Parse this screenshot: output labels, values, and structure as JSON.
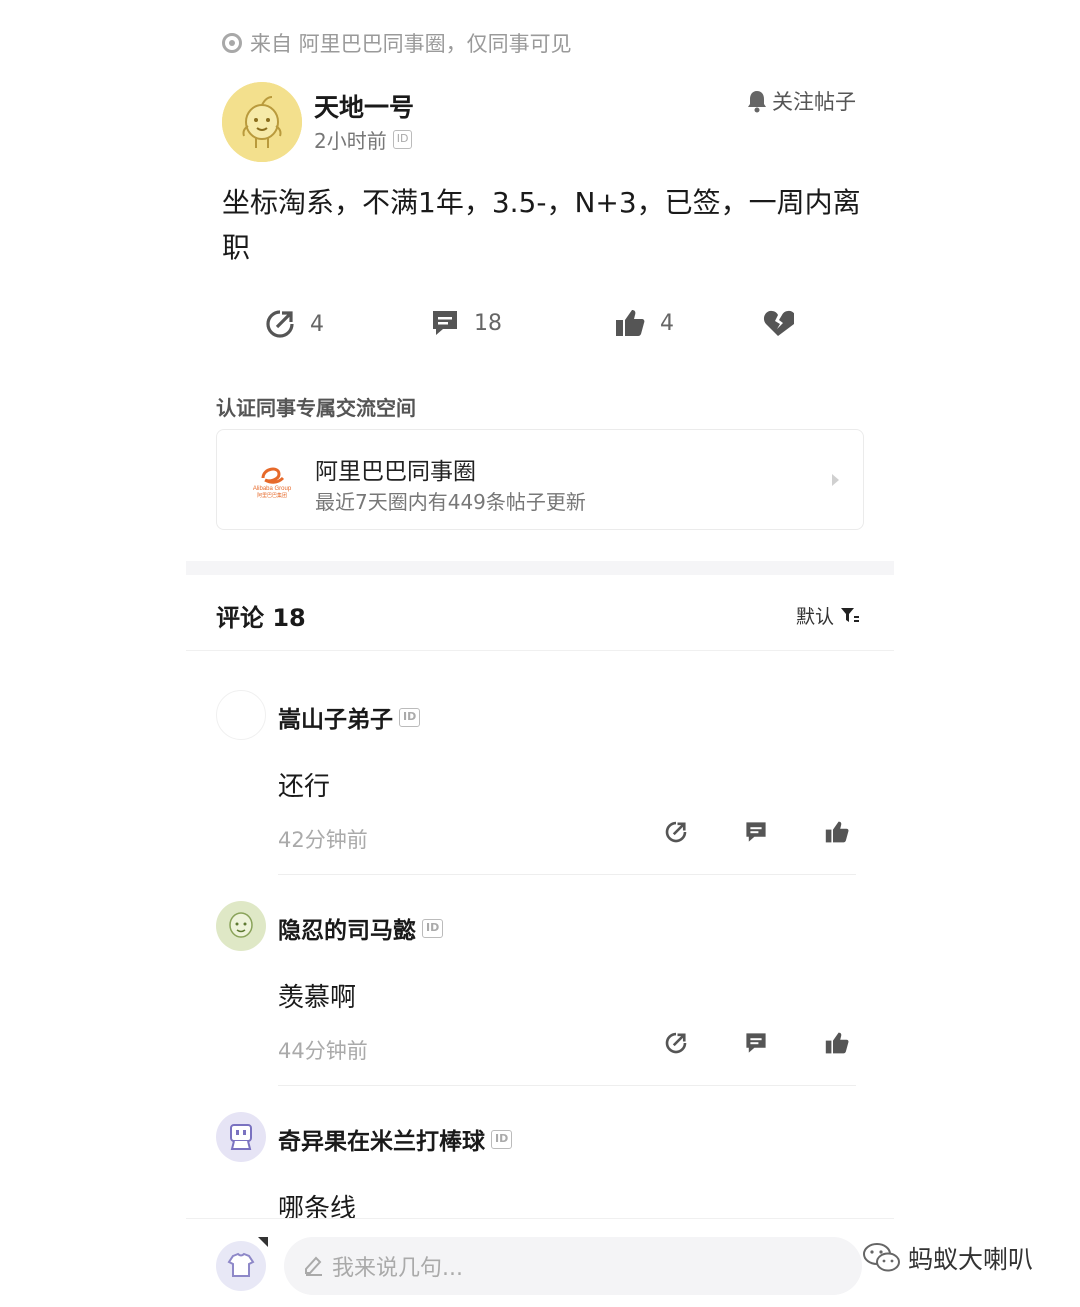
{
  "source_text": "来自 阿里巴巴同事圈，仅同事可见",
  "author": {
    "name": "天地一号",
    "time": "2小时前",
    "id_badge": "ID"
  },
  "follow_label": "关注帖子",
  "post_text": "坐标淘系，不满1年，3.5-，N+3，已签，一周内离职",
  "actions": {
    "share_count": "4",
    "comment_count": "18",
    "like_count": "4"
  },
  "circle_section_label": "认证同事专属交流空间",
  "circle": {
    "name": "阿里巴巴同事圈",
    "subtitle": "最近7天圈内有449条帖子更新",
    "logo_text": "Alibaba Group",
    "logo_cn": "阿里巴巴集团"
  },
  "comments_header": "评论 18",
  "sort_label": "默认",
  "comments": [
    {
      "name": "嵩山子弟子",
      "id_badge": "ID",
      "text": "还行",
      "time": "42分钟前"
    },
    {
      "name": "隐忍的司马懿",
      "id_badge": "ID",
      "text": "羡慕啊",
      "time": "44分钟前"
    },
    {
      "name": "奇异果在米兰打棒球",
      "id_badge": "ID",
      "text": "哪条线",
      "time": ""
    }
  ],
  "input_placeholder": "我来说几句...",
  "watermark": "蚂蚁大喇叭",
  "colors": {
    "accent_gold": "#f3e08d",
    "icon_gray": "#555555",
    "avatar_green": "#dfe8c6",
    "avatar_lavender": "#e6e4f5"
  }
}
